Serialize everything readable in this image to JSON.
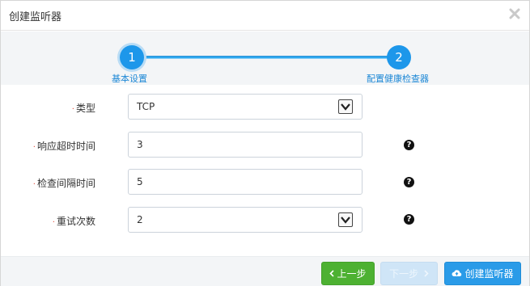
{
  "dialog": {
    "title": "创建监听器"
  },
  "steps": [
    {
      "number": "1",
      "label": "基本设置"
    },
    {
      "number": "2",
      "label": "配置健康检查器"
    }
  ],
  "form": {
    "type": {
      "label": "类型",
      "value": "TCP"
    },
    "timeout": {
      "label": "响应超时时间",
      "value": "3"
    },
    "interval": {
      "label": "检查间隔时间",
      "value": "5"
    },
    "retries": {
      "label": "重试次数",
      "value": "2"
    },
    "required_mark": "·",
    "help_glyph": "?"
  },
  "footer": {
    "prev_label": "上一步",
    "next_label": "下一步",
    "create_label": "创建监听器"
  },
  "colors": {
    "accent": "#1d97ea",
    "success": "#4db132",
    "disabled": "#cfe5f7"
  }
}
